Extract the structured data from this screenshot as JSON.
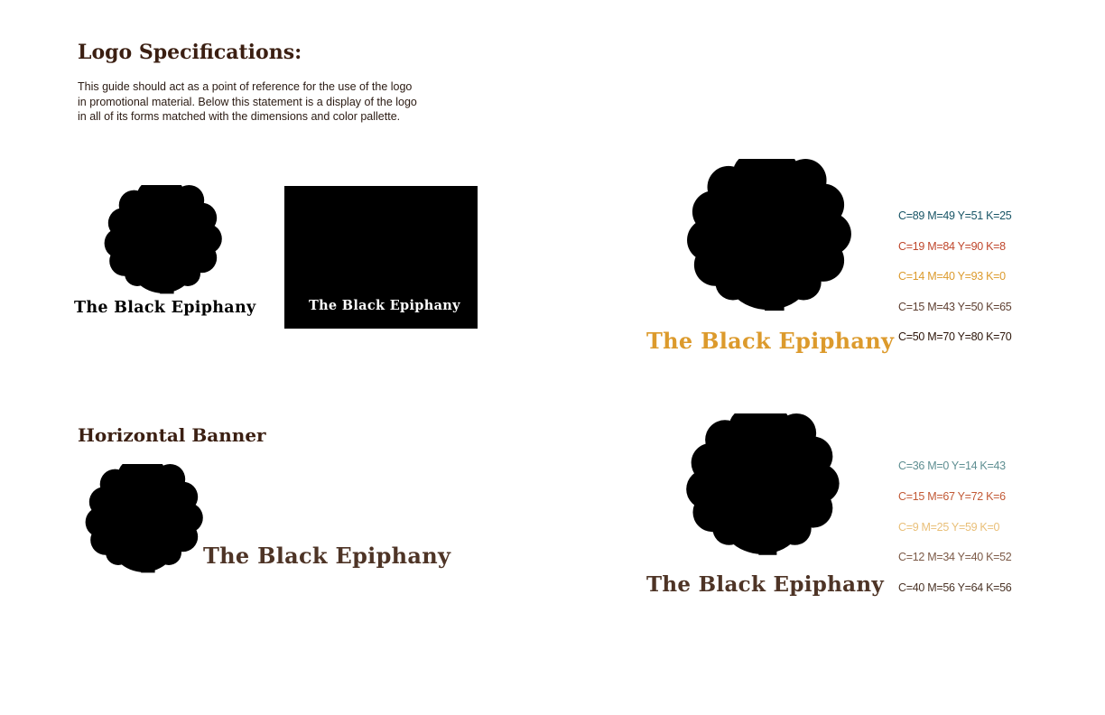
{
  "header": {
    "title": "Logo Specifications:",
    "intro": [
      "This guide should act as a point of reference for the use of the logo",
      "in promotional material. Below this statement is a display of the logo",
      "in all of its forms matched with the dimensions and color pallette."
    ]
  },
  "brand_name": "The Black Epiphany",
  "sections": {
    "banner_title": "Horizontal Banner"
  },
  "palettes": {
    "primary": [
      {
        "label": "C=89 M=49 Y=51 K=25",
        "color": "#185566"
      },
      {
        "label": "C=19 M=84 Y=90 K=8",
        "color": "#bf462b"
      },
      {
        "label": "C=14 M=40 Y=93 K=0",
        "color": "#dc9a2c"
      },
      {
        "label": "C=15 M=43 Y=50 K=65",
        "color": "#5e3f31"
      },
      {
        "label": "C=50 M=70 Y=80 K=70",
        "color": "#2c1509"
      }
    ],
    "muted": [
      {
        "label": "C=36 M=0 Y=14 K=43",
        "color": "#5f8f92"
      },
      {
        "label": "C=15 M=67 Y=72 K=6",
        "color": "#c25935"
      },
      {
        "label": "C=9 M=25 Y=59 K=0",
        "color": "#e9bf78"
      },
      {
        "label": "C=12 M=34 Y=40 K=52",
        "color": "#7c5a47"
      },
      {
        "label": "C=40 M=56 Y=64 K=56",
        "color": "#4a3326"
      }
    ]
  },
  "colors": {
    "heading": "#3b1f12",
    "wordmark_primary": "#dc9a2c",
    "wordmark_muted": "#4e3426",
    "wordmark_banner": "#4e3426",
    "black": "#000000",
    "white": "#ffffff"
  }
}
